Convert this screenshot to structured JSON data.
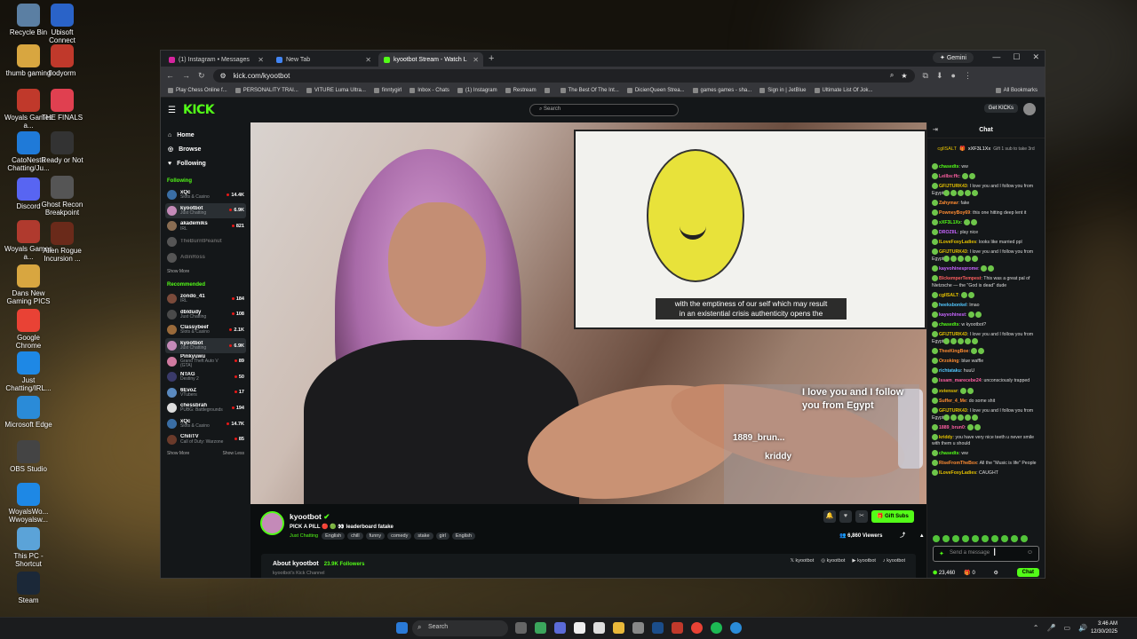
{
  "desktop": {
    "icons": [
      {
        "label": "Recycle Bin",
        "color": "#5b7fa3"
      },
      {
        "label": "thumb gaming",
        "color": "#d8a640"
      },
      {
        "label": "Woyals Games a...",
        "color": "#c0392b"
      },
      {
        "label": "CatoNesto Chatting/Ju...",
        "color": "#1f7ad8"
      },
      {
        "label": "Discord",
        "color": "#5865f2"
      },
      {
        "label": "Woyals Games a...",
        "color": "#b03a2e"
      },
      {
        "label": "Dans New Gaming PICS",
        "color": "#d8a640"
      },
      {
        "label": "Google Chrome",
        "color": "#e94235"
      },
      {
        "label": "Just Chatting/IRL...",
        "color": "#1e88e5"
      },
      {
        "label": "Microsoft Edge",
        "color": "#2a8bd8"
      },
      {
        "label": "OBS Studio",
        "color": "#444"
      },
      {
        "label": "WoyalsWo... Wwoyalsw...",
        "color": "#1e88e5"
      },
      {
        "label": "This PC - Shortcut",
        "color": "#5ba3d8"
      },
      {
        "label": "Steam",
        "color": "#1b2838"
      },
      {
        "label": "Ubisoft Connect",
        "color": "#2a63c8"
      },
      {
        "label": "flodyorm",
        "color": "#c0392b"
      },
      {
        "label": "THE FINALS",
        "color": "#e04050"
      },
      {
        "label": "Ready or Not",
        "color": "#333"
      },
      {
        "label": "Ghost Recon Breakpoint",
        "color": "#555"
      },
      {
        "label": "Alien Rogue Incursion ...",
        "color": "#6a2a1a"
      }
    ]
  },
  "browser": {
    "tabs": [
      {
        "label": "(1) Instagram • Messages",
        "fav": "#d6249f",
        "active": false
      },
      {
        "label": "New Tab",
        "fav": "#4285f4",
        "active": false
      },
      {
        "label": "kyootbot Stream - Watch L",
        "fav": "#53fc18",
        "active": true
      }
    ],
    "gemini": "Gemini",
    "url": "kick.com/kyootbot",
    "bookmarks": [
      "Play Chess Online f...",
      "PERSONALITY TRAI...",
      "VITURE Luma Ultra...",
      "finntygirl",
      "Inbox - Chats",
      "(1) Instagram",
      "Restream",
      "",
      "The Best Of The Int...",
      "DicienQueen Strea...",
      "games games - sha...",
      "Sign in | JetBlue",
      "Ultimate List Of Jok...",
      "All Bookmarks"
    ]
  },
  "kick": {
    "logo": "KICK",
    "search_placeholder": "Search",
    "get_kicks": "Get KICKs",
    "nav": [
      {
        "label": "Home",
        "icon": "⌂"
      },
      {
        "label": "Browse",
        "icon": "◎"
      },
      {
        "label": "Following",
        "icon": "♥"
      }
    ],
    "following_header": "Following",
    "following": [
      {
        "name": "xQc",
        "cat": "Slots & Casino",
        "viewers": "14.4K",
        "color": "#3a6ea5",
        "off": false
      },
      {
        "name": "kyootbot",
        "cat": "Just Chatting",
        "viewers": "6.9K",
        "color": "#c48ab8",
        "off": false,
        "sel": true
      },
      {
        "name": "akademiks",
        "cat": "IRL",
        "viewers": "821",
        "color": "#8a6d52",
        "off": false
      },
      {
        "name": "TheBurntPeanut",
        "cat": "",
        "viewers": "",
        "color": "#555",
        "off": true
      },
      {
        "name": "AdinRoss",
        "cat": "",
        "viewers": "",
        "color": "#555",
        "off": true
      }
    ],
    "recommended_header": "Recommended",
    "recommended": [
      {
        "name": "zondo_41",
        "cat": "IRL",
        "viewers": "184",
        "color": "#7a4a3a"
      },
      {
        "name": "dbldudy",
        "cat": "Just Chatting",
        "viewers": "108",
        "color": "#4a4a4a"
      },
      {
        "name": "Classybeef",
        "cat": "Slots & Casino",
        "viewers": "2.1K",
        "color": "#9a6a3a"
      },
      {
        "name": "kyootbot",
        "cat": "Just Chatting",
        "viewers": "6.9K",
        "color": "#c48ab8",
        "sel": true
      },
      {
        "name": "Pinkyuwu",
        "cat": "Grand Theft Auto V (GTA)",
        "viewers": "89",
        "color": "#d07aa0"
      },
      {
        "name": "NTAG",
        "cat": "Destiny 2",
        "viewers": "50",
        "color": "#3a3a6a"
      },
      {
        "name": "6EvoZ",
        "cat": "VTubers",
        "viewers": "17",
        "color": "#5a8ac0"
      },
      {
        "name": "chessbrah",
        "cat": "PUBG: Battlegrounds",
        "viewers": "194",
        "color": "#ddd"
      },
      {
        "name": "xQc",
        "cat": "Slots & Casino",
        "viewers": "14.7K",
        "color": "#3a6ea5"
      },
      {
        "name": "ChiliTV",
        "cat": "Call of Duty: Warzone",
        "viewers": "85",
        "color": "#6a3a2a"
      }
    ],
    "show_more": "Show More",
    "show_less": "Show Less",
    "caption_line1": "with the emptiness of our self which may result",
    "caption_line2": "in an existential crisis authenticity opens the",
    "overlay_msg": "I love you and I follow you from Egypt",
    "overlay_user1": "1889_brun...",
    "overlay_user2": "kriddy",
    "streamer": {
      "name": "kyootbot",
      "title": "PICK A PILL 🔴 🟢 👀 leaderboard fatake",
      "category": "Just Chatting",
      "tags": [
        "English",
        "chill",
        "funny",
        "comedy",
        "stake",
        "girl",
        "English"
      ],
      "viewers": "6,860 Viewers",
      "gift": "Gift Subs",
      "about_label": "About kyootbot",
      "followers": "23.9K Followers",
      "socials": [
        "kyootbot",
        "kyootbot",
        "kyootbot",
        "kyootbot"
      ],
      "kick_channel": "kyootbot's Kick Channel"
    },
    "chat": {
      "title": "Chat",
      "pinned_user1": "cgllSALT",
      "pinned_user2": "xXF3L1Xx",
      "pinned_sub": "Gift 1 sub to take 3rd",
      "messages": [
        {
          "user": "chasedts",
          "color": "#53fc18",
          "text": "ww"
        },
        {
          "user": "Leilbs:ffc",
          "color": "#ff5fa2",
          "text": ""
        },
        {
          "user": "GFIJTURK43",
          "color": "#e6c200",
          "text": "I love you and I follow you from Egypt"
        },
        {
          "user": "Zahymar",
          "color": "#ff8c32",
          "text": "fake"
        },
        {
          "user": "PowneyBoy69",
          "color": "#ff8c32",
          "text": "this one hitting deep lent it"
        },
        {
          "user": "xXF3L1Xx",
          "color": "#53fc18",
          "text": ""
        },
        {
          "user": "DROZIIL",
          "color": "#c865ff",
          "text": "play nice"
        },
        {
          "user": "ILoveFoxyLadies",
          "color": "#e6c200",
          "text": "looks like married ppl"
        },
        {
          "user": "GFIJTURK43",
          "color": "#e6c200",
          "text": "I love you and I follow you from Egypt"
        },
        {
          "user": "kayvohinesprome",
          "color": "#c865ff",
          "text": ""
        },
        {
          "user": "BlckemperTempest",
          "color": "#ff5f5f",
          "text": "This was a great pal of Nietzsche — the \"God is dead\" dude"
        },
        {
          "user": "cgllSALT",
          "color": "#e6c200",
          "text": ""
        },
        {
          "user": "heeksbonkel",
          "color": "#53c8ff",
          "text": "lmao"
        },
        {
          "user": "kayvohinest",
          "color": "#c865ff",
          "text": ""
        },
        {
          "user": "chasedts",
          "color": "#53fc18",
          "text": "w kyootbot?"
        },
        {
          "user": "GFIJTURK43",
          "color": "#e6c200",
          "text": "I love you and I follow you from Egypt"
        },
        {
          "user": "TheeKingBoe",
          "color": "#ff8c32",
          "text": ""
        },
        {
          "user": "Orzoking",
          "color": "#ff8c32",
          "text": "blue waffle"
        },
        {
          "user": "richtataku",
          "color": "#53c8ff",
          "text": "huuU"
        },
        {
          "user": "Issam_marecebe24",
          "color": "#ff5fa2",
          "text": "unconsciously trapped"
        },
        {
          "user": "xvienssr",
          "color": "#e6c200",
          "text": ""
        },
        {
          "user": "Suffer_4_Me",
          "color": "#ff8c32",
          "text": "do some shit"
        },
        {
          "user": "GFIJTURK43",
          "color": "#e6c200",
          "text": "I love you and I follow you from Egypt"
        },
        {
          "user": "1889_brun0",
          "color": "#ff5fa2",
          "text": ""
        },
        {
          "user": "kriddy",
          "color": "#e6c200",
          "text": "you have very nice teeth u never smile with them u should"
        },
        {
          "user": "chasedts",
          "color": "#53fc18",
          "text": "ww"
        },
        {
          "user": "RiseFromTheBox",
          "color": "#ff8c32",
          "text": "All the \"Music is life\" People"
        },
        {
          "user": "ILoveFoxyLadies",
          "color": "#e6c200",
          "text": "CAUGHT"
        }
      ],
      "input_placeholder": "Send a message",
      "points": "23,460",
      "gift_count": "0",
      "chat_button": "Chat"
    }
  },
  "taskbar": {
    "search": "Search",
    "time": "3:46 AM",
    "date": "12/30/2025"
  }
}
